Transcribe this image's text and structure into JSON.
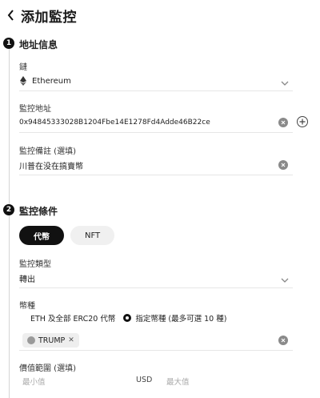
{
  "header": {
    "title": "添加監控"
  },
  "section1": {
    "step": "1",
    "title": "地址信息",
    "chain": {
      "label": "鏈",
      "value": "Ethereum"
    },
    "address": {
      "label": "監控地址",
      "value": "0x94845333028B1204Fbe14E1278Fd4Adde46B22ce"
    },
    "note": {
      "label": "監控備註 (選填)",
      "value": "川普在没在搞賣幣"
    }
  },
  "section2": {
    "step": "2",
    "title": "監控條件",
    "tabs": [
      {
        "label": "代幣",
        "active": true
      },
      {
        "label": "NFT",
        "active": false
      }
    ],
    "monitor_type": {
      "label": "監控類型",
      "value": "轉出"
    },
    "currency": {
      "label": "幣種",
      "option_all": "ETH 及全部 ERC20 代幣",
      "option_specific": "指定幣種 (最多可選 10 種)",
      "selected_token": "TRUMP"
    },
    "range": {
      "label": "價值範圍 (選填)",
      "min_placeholder": "最小值",
      "unit": "USD",
      "max_placeholder": "最大值"
    }
  },
  "colors": {
    "primary": "#111111",
    "muted": "#8a8a8a"
  }
}
